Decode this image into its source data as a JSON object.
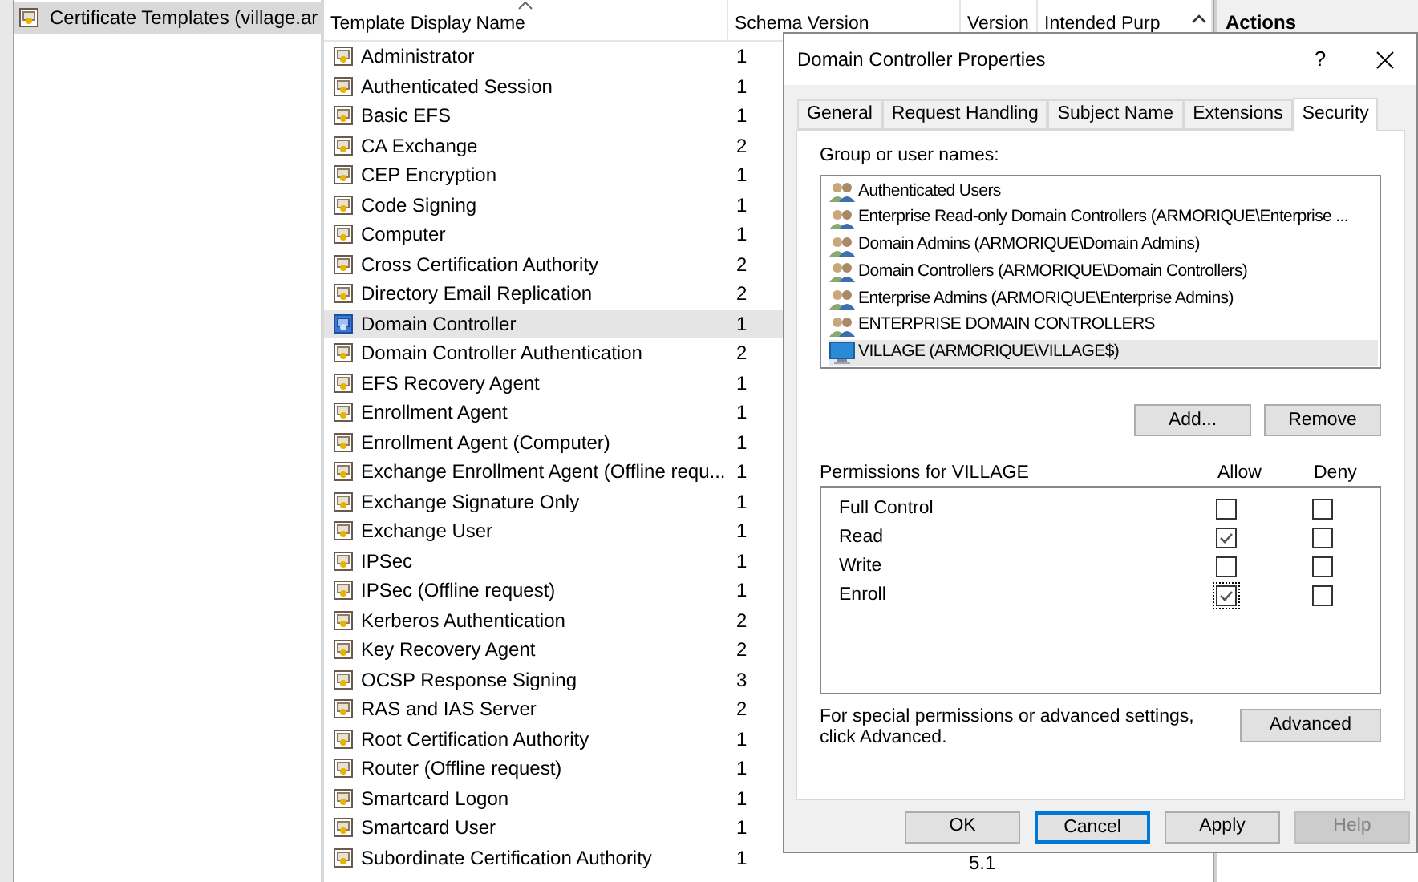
{
  "tree": {
    "items": [
      {
        "label": "Certificate Templates (village.ar",
        "selected": true
      }
    ]
  },
  "list": {
    "columns": [
      "Template Display Name",
      "Schema Version",
      "Version",
      "Intended Purp"
    ],
    "rows": [
      {
        "name": "Administrator",
        "schema_version": "1",
        "selected": false
      },
      {
        "name": "Authenticated Session",
        "schema_version": "1",
        "selected": false
      },
      {
        "name": "Basic EFS",
        "schema_version": "1",
        "selected": false
      },
      {
        "name": "CA Exchange",
        "schema_version": "2",
        "selected": false
      },
      {
        "name": "CEP Encryption",
        "schema_version": "1",
        "selected": false
      },
      {
        "name": "Code Signing",
        "schema_version": "1",
        "selected": false
      },
      {
        "name": "Computer",
        "schema_version": "1",
        "selected": false
      },
      {
        "name": "Cross Certification Authority",
        "schema_version": "2",
        "selected": false
      },
      {
        "name": "Directory Email Replication",
        "schema_version": "2",
        "selected": false
      },
      {
        "name": "Domain Controller",
        "schema_version": "1",
        "selected": true
      },
      {
        "name": "Domain Controller Authentication",
        "schema_version": "2",
        "selected": false
      },
      {
        "name": "EFS Recovery Agent",
        "schema_version": "1",
        "selected": false
      },
      {
        "name": "Enrollment Agent",
        "schema_version": "1",
        "selected": false
      },
      {
        "name": "Enrollment Agent (Computer)",
        "schema_version": "1",
        "selected": false
      },
      {
        "name": "Exchange Enrollment Agent (Offline requ...",
        "schema_version": "1",
        "selected": false
      },
      {
        "name": "Exchange Signature Only",
        "schema_version": "1",
        "selected": false
      },
      {
        "name": "Exchange User",
        "schema_version": "1",
        "selected": false
      },
      {
        "name": "IPSec",
        "schema_version": "1",
        "selected": false
      },
      {
        "name": "IPSec (Offline request)",
        "schema_version": "1",
        "selected": false
      },
      {
        "name": "Kerberos Authentication",
        "schema_version": "2",
        "selected": false
      },
      {
        "name": "Key Recovery Agent",
        "schema_version": "2",
        "selected": false
      },
      {
        "name": "OCSP Response Signing",
        "schema_version": "3",
        "selected": false
      },
      {
        "name": "RAS and IAS Server",
        "schema_version": "2",
        "selected": false
      },
      {
        "name": "Root Certification Authority",
        "schema_version": "1",
        "selected": false
      },
      {
        "name": "Router (Offline request)",
        "schema_version": "1",
        "selected": false
      },
      {
        "name": "Smartcard Logon",
        "schema_version": "1",
        "selected": false
      },
      {
        "name": "Smartcard User",
        "schema_version": "1",
        "selected": false
      },
      {
        "name": "Subordinate Certification Authority",
        "schema_version": "1",
        "version": "5.1",
        "selected": false
      }
    ]
  },
  "actions_pane": {
    "title": "Actions"
  },
  "dialog": {
    "title": "Domain Controller Properties",
    "help": "?",
    "tabs": [
      {
        "label": "General",
        "selected": false
      },
      {
        "label": "Request Handling",
        "selected": false
      },
      {
        "label": "Subject Name",
        "selected": false
      },
      {
        "label": "Extensions",
        "selected": false
      },
      {
        "label": "Security",
        "selected": true
      }
    ],
    "users_label": "Group or user names:",
    "users": [
      {
        "name": "Authenticated Users",
        "kind": "group",
        "selected": false
      },
      {
        "name": "Enterprise Read-only Domain Controllers (ARMORIQUE\\Enterprise ...",
        "kind": "group",
        "selected": false
      },
      {
        "name": "Domain Admins (ARMORIQUE\\Domain Admins)",
        "kind": "group",
        "selected": false
      },
      {
        "name": "Domain Controllers (ARMORIQUE\\Domain Controllers)",
        "kind": "group",
        "selected": false
      },
      {
        "name": "Enterprise Admins (ARMORIQUE\\Enterprise Admins)",
        "kind": "group",
        "selected": false
      },
      {
        "name": "ENTERPRISE DOMAIN CONTROLLERS",
        "kind": "group",
        "selected": false
      },
      {
        "name": "VILLAGE (ARMORIQUE\\VILLAGE$)",
        "kind": "computer",
        "selected": true
      }
    ],
    "user_buttons": [
      "Add...",
      "Remove"
    ],
    "permissions_label": "Permissions for VILLAGE",
    "allow_label": "Allow",
    "deny_label": "Deny",
    "permissions": [
      {
        "name": "Full Control",
        "allow": false,
        "deny": false,
        "focused": false
      },
      {
        "name": "Read",
        "allow": true,
        "deny": false,
        "focused": false
      },
      {
        "name": "Write",
        "allow": false,
        "deny": false,
        "focused": false
      },
      {
        "name": "Enroll",
        "allow": true,
        "deny": false,
        "focused": true
      }
    ],
    "advanced_text": "For special permissions or advanced settings, click Advanced.",
    "advanced_button": "Advanced",
    "buttons": [
      {
        "label": "OK",
        "default": false,
        "disabled": false
      },
      {
        "label": "Cancel",
        "default": true,
        "disabled": false
      },
      {
        "label": "Apply",
        "default": false,
        "disabled": false
      },
      {
        "label": "Help",
        "default": false,
        "disabled": true
      }
    ]
  }
}
